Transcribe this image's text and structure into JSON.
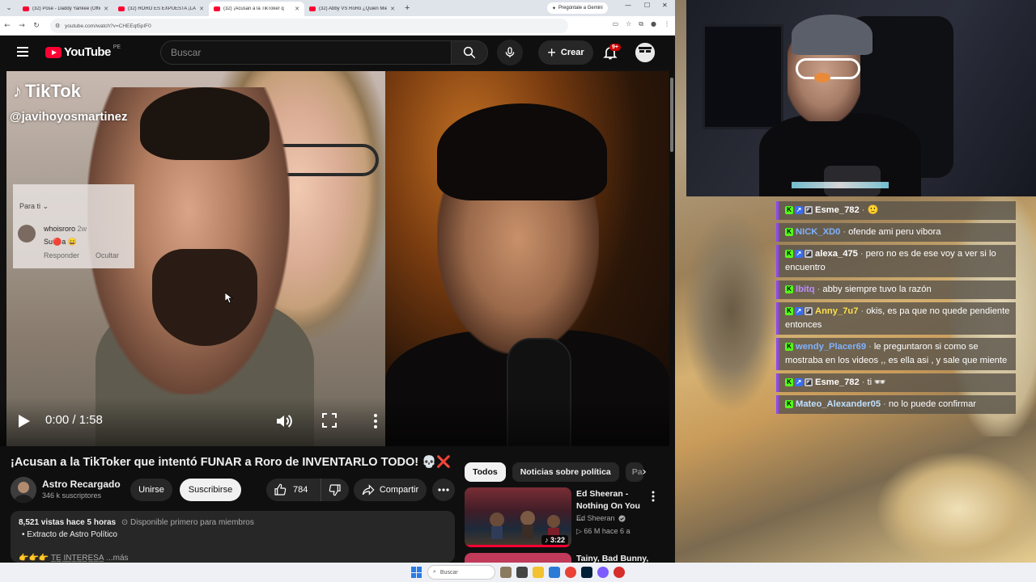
{
  "browser": {
    "tabs": [
      {
        "title": "(32) Pose - Daddy Yankee (Offic",
        "active": false
      },
      {
        "title": "(32) RORO ES EXPUESTA ¡LA TIK",
        "active": false
      },
      {
        "title": "(32) ¡Acusan a la TikToker q",
        "active": true
      },
      {
        "title": "(32) Abby VS RoRo ¿Quién Mie",
        "active": false
      }
    ],
    "new_tab": "+",
    "gemini_label": "Pregúntale a Gemini",
    "url": "youtube.com/watch?v=CHEEqt5pIF0"
  },
  "yt": {
    "logo_text": "YouTube",
    "country_code": "PE",
    "search_placeholder": "Buscar",
    "create_label": "Crear",
    "notif_badge": "9+"
  },
  "video_overlay": {
    "tiktok_logo": "TikTok",
    "tiktok_handle": "@javihoyosmartinez",
    "para_ti": "Para ti ⌄",
    "comment_user": "whoisroro",
    "comment_age": "2w",
    "comment_text": "Su🔴a 😄",
    "reply": "Responder",
    "hide": "Ocultar"
  },
  "player": {
    "time": "0:00 / 1:58"
  },
  "video": {
    "title": "¡Acusan a la TikToker que intentó FUNAR a Roro de INVENTARLO TODO! 💀❌",
    "channel": "Astro Recargado",
    "subscribers": "346 k suscriptores",
    "join_label": "Unirse",
    "subscribe_label": "Suscribirse",
    "likes": "784",
    "share_label": "Compartir",
    "views_time": "8,521 vistas  hace 5 horas",
    "early_access": "⊙ Disponible primero para miembros",
    "desc_line": "•  Extracto de Astro Político",
    "desc_line2": "👉👉👉 T̲E̲ I̲N̲T̲E̲R̲E̲S̲A̲ ...más"
  },
  "chips": [
    "Todos",
    "Noticias sobre política",
    "Pa"
  ],
  "recommendations": [
    {
      "title": "Ed Sheeran - Nothing On You ...",
      "channel": "Ed Sheeran",
      "stats": "▷ 66 M   hace 6 a",
      "duration": "♪ 3:22",
      "progress": 1.0
    },
    {
      "title": "Tainy, Bad Bunny,"
    }
  ],
  "chat": [
    {
      "user": "Esme_782",
      "color": "#ffffff",
      "text": "🙂",
      "badges": [
        "k",
        "a",
        "c"
      ]
    },
    {
      "user": "NICK_XD0",
      "color": "#7fb2ff",
      "text": "ofende ami peru vibora",
      "badges": [
        "k"
      ]
    },
    {
      "user": "alexa_475",
      "color": "#ffffff",
      "text": "pero no es de ese voy a ver si lo encuentro",
      "badges": [
        "k",
        "a",
        "c"
      ]
    },
    {
      "user": "lbitq",
      "color": "#b98cff",
      "text": "abby siempre tuvo la razón",
      "badges": [
        "k"
      ]
    },
    {
      "user": "Anny_7u7",
      "color": "#ffe04a",
      "text": "okis, es pa que no quede pendiente entonces",
      "badges": [
        "k",
        "a",
        "c"
      ]
    },
    {
      "user": "wendy_Placer69",
      "color": "#7fb2ff",
      "text": "le preguntaron si como se mostraba en los videos ,, es ella asi , y sale que miente",
      "badges": [
        "k"
      ]
    },
    {
      "user": "Esme_782",
      "color": "#ffffff",
      "text": "ti 🕶",
      "badges": [
        "k",
        "a",
        "c"
      ]
    },
    {
      "user": "Mateo_Alexander05",
      "color": "#bfe0ff",
      "text": "no lo puede confirmar",
      "badges": [
        "k"
      ]
    }
  ],
  "taskbar": {
    "search_placeholder": "Buscar"
  },
  "colors": {
    "yt_red": "#ff0033",
    "kick_green": "#53fc18",
    "yt_bg": "#0f0f0f"
  }
}
